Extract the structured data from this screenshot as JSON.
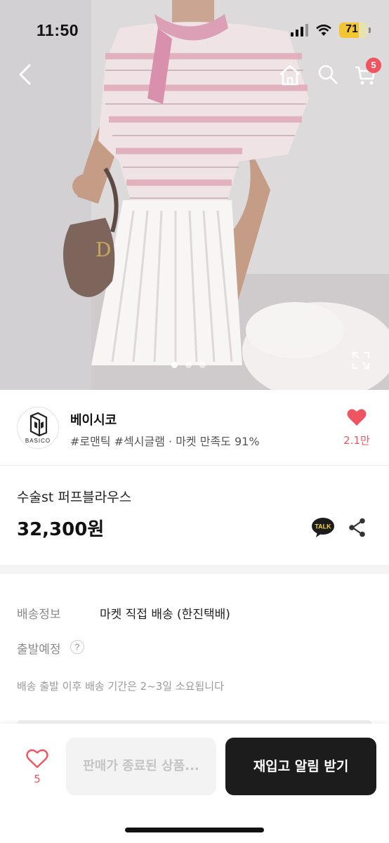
{
  "status_bar": {
    "time": "11:50",
    "battery": "71"
  },
  "nav": {
    "cart_count": "5"
  },
  "gallery": {
    "image_count": 3,
    "active_index": 0
  },
  "icons": {
    "back": "chevron-left-icon",
    "home": "home-icon",
    "search": "search-icon",
    "cart": "cart-icon",
    "expand": "expand-icon",
    "like": "heart-icon",
    "talk": "kakao-talk-icon",
    "share": "share-icon",
    "help": "question-icon"
  },
  "seller": {
    "name": "베이시코",
    "logo_text": "BASICO",
    "tags": "#로맨틱 #섹시글램 · 마켓 만족도 91%",
    "like_count": "2.1만"
  },
  "product": {
    "title": "수술st 퍼프블라우스",
    "price": "32,300원",
    "talk_label": "TALK"
  },
  "shipping": {
    "label": "배송정보",
    "value": "마켓 직접 배송 (한진택배)",
    "depart_label": "출발예정",
    "help": "?",
    "note": "배송 출발 이후 배송 기간은 2~3일 소요됩니다"
  },
  "bottom_bar": {
    "like_count": "5",
    "sold_out_label": "판매가 종료된 상품...",
    "restock_label": "재입고 알림 받기"
  },
  "colors": {
    "accent_red": "#ef5560",
    "badge_red": "#f0545d",
    "primary_dark": "#1c1c1c",
    "battery_yellow": "#f2c531"
  }
}
